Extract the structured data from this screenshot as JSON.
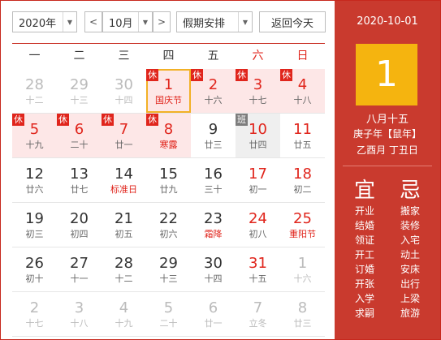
{
  "toolbar": {
    "year": "2020年",
    "prev": "<",
    "month": "10月",
    "next": ">",
    "holiday_select": "假期安排",
    "today_btn": "返回今天"
  },
  "weekdays": [
    "一",
    "二",
    "三",
    "四",
    "五",
    "六",
    "日"
  ],
  "weeks": [
    [
      {
        "d": "28",
        "l": "十二",
        "o": true
      },
      {
        "d": "29",
        "l": "十三",
        "o": true
      },
      {
        "d": "30",
        "l": "十四",
        "o": true
      },
      {
        "d": "1",
        "l": "国庆节",
        "b": "休",
        "fest": true,
        "sel": true
      },
      {
        "d": "2",
        "l": "十六",
        "b": "休"
      },
      {
        "d": "3",
        "l": "十七",
        "b": "休"
      },
      {
        "d": "4",
        "l": "十八",
        "b": "休"
      }
    ],
    [
      {
        "d": "5",
        "l": "十九",
        "b": "休"
      },
      {
        "d": "6",
        "l": "二十",
        "b": "休"
      },
      {
        "d": "7",
        "l": "廿一",
        "b": "休"
      },
      {
        "d": "8",
        "l": "寒露",
        "b": "休",
        "fest": true
      },
      {
        "d": "9",
        "l": "廿三"
      },
      {
        "d": "10",
        "l": "廿四",
        "b": "班"
      },
      {
        "d": "11",
        "l": "廿五"
      }
    ],
    [
      {
        "d": "12",
        "l": "廿六"
      },
      {
        "d": "13",
        "l": "廿七"
      },
      {
        "d": "14",
        "l": "标准日",
        "fest": true
      },
      {
        "d": "15",
        "l": "廿九"
      },
      {
        "d": "16",
        "l": "三十"
      },
      {
        "d": "17",
        "l": "初一"
      },
      {
        "d": "18",
        "l": "初二"
      }
    ],
    [
      {
        "d": "19",
        "l": "初三"
      },
      {
        "d": "20",
        "l": "初四"
      },
      {
        "d": "21",
        "l": "初五"
      },
      {
        "d": "22",
        "l": "初六"
      },
      {
        "d": "23",
        "l": "霜降",
        "fest": true
      },
      {
        "d": "24",
        "l": "初八"
      },
      {
        "d": "25",
        "l": "重阳节",
        "fest": true
      }
    ],
    [
      {
        "d": "26",
        "l": "初十"
      },
      {
        "d": "27",
        "l": "十一"
      },
      {
        "d": "28",
        "l": "十二"
      },
      {
        "d": "29",
        "l": "十三"
      },
      {
        "d": "30",
        "l": "十四"
      },
      {
        "d": "31",
        "l": "十五"
      },
      {
        "d": "1",
        "l": "十六",
        "o": true
      }
    ],
    [
      {
        "d": "2",
        "l": "十七",
        "o": true
      },
      {
        "d": "3",
        "l": "十八",
        "o": true
      },
      {
        "d": "4",
        "l": "十九",
        "o": true
      },
      {
        "d": "5",
        "l": "二十",
        "o": true
      },
      {
        "d": "6",
        "l": "廿一",
        "o": true
      },
      {
        "d": "7",
        "l": "立冬",
        "o": true
      },
      {
        "d": "8",
        "l": "廿三",
        "o": true
      }
    ]
  ],
  "detail": {
    "date": "2020-10-01",
    "day": "1",
    "lunar": "八月十五",
    "year_gz": "庚子年【鼠年】",
    "month_day_gz": "乙酉月 丁丑日",
    "yi_title": "宜",
    "ji_title": "忌",
    "yi": [
      "开业",
      "结婚",
      "领证",
      "开工",
      "订婚",
      "开张",
      "入学",
      "求嗣"
    ],
    "ji": [
      "搬家",
      "装修",
      "入宅",
      "动土",
      "安床",
      "出行",
      "上梁",
      "旅游"
    ]
  },
  "colors": {
    "accent": "#c93a2e",
    "holiday_bg": "#fde7e7",
    "today_box": "#f5b40f"
  }
}
